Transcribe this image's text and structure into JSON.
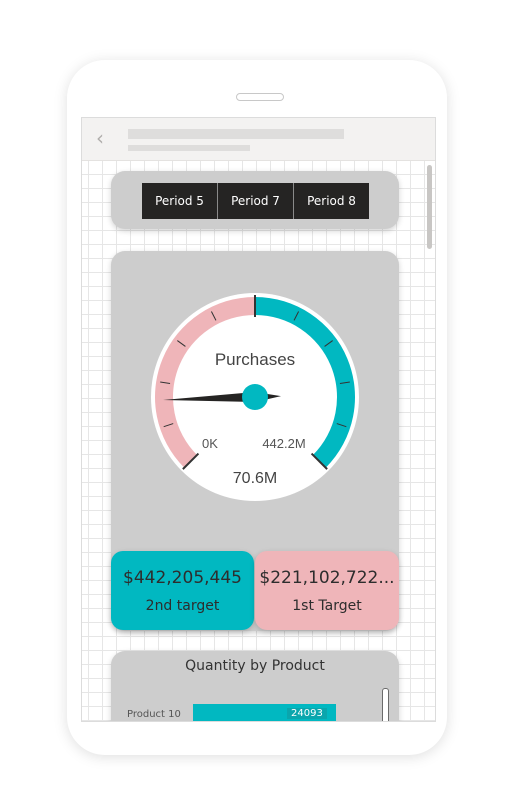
{
  "slicer": {
    "buttons": [
      "Period 5",
      "Period 7",
      "Period 8"
    ]
  },
  "gauge": {
    "title": "Purchases",
    "min_label": "0K",
    "max_label": "442.2M",
    "value_label": "70.6M",
    "min": 0,
    "max": 442205445,
    "value": 70600000,
    "target": 221102722,
    "colors": {
      "filled": "#efb5b9",
      "remaining": "#01b8c1",
      "needle": "#252423",
      "hub": "#01b8c1"
    }
  },
  "kpis": [
    {
      "value": "$442,205,445",
      "label": "2nd target",
      "color": "#01b8c1"
    },
    {
      "value": "$221,102,722...",
      "label": "1st Target",
      "color": "#efb5b9"
    }
  ],
  "bar_chart": {
    "title": "Quantity by Product",
    "color": "#01b8c1"
  },
  "chart_data": {
    "type": "bar",
    "categories": [
      "Product 10"
    ],
    "values": [
      24093
    ]
  }
}
